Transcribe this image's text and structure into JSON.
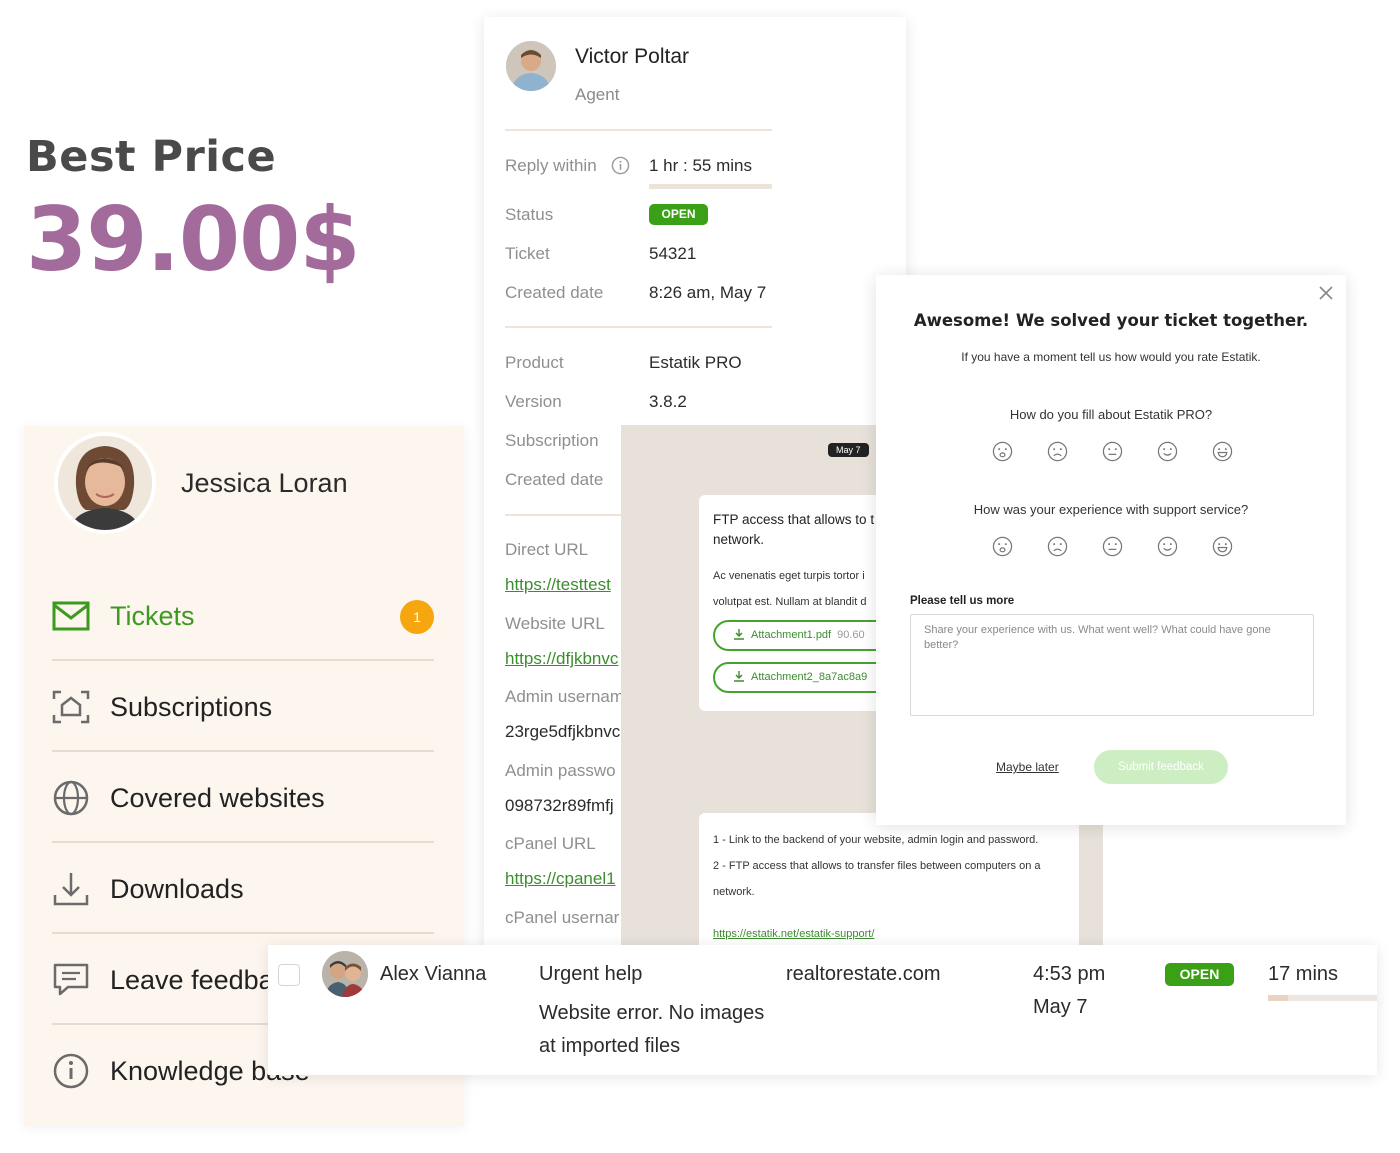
{
  "promo": {
    "label": "Best Price",
    "price": "39.00$"
  },
  "ticket_detail": {
    "agent_name": "Victor Poltar",
    "agent_role": "Agent",
    "reply_within_label": "Reply within",
    "reply_within_value": "1 hr : 55 mins",
    "status_label": "Status",
    "status_value": "OPEN",
    "ticket_label": "Ticket",
    "ticket_value": "54321",
    "created_label": "Created date",
    "created_value": "8:26 am, May 7",
    "product_label": "Product",
    "product_value": "Estatik PRO",
    "version_label": "Version",
    "version_value": "3.8.2",
    "subscription_label": "Subscription",
    "created2_label": "Created date",
    "direct_url_label": "Direct URL",
    "direct_url_value": "https://testtest",
    "website_url_label": "Website URL",
    "website_url_value": "https://dfjkbnvc",
    "admin_user_label": "Admin usernam",
    "admin_user_value": "23rge5dfjkbnvc",
    "admin_pass_label": "Admin passwo",
    "admin_pass_value": "098732r89fmfj",
    "cpanel_url_label": "cPanel URL",
    "cpanel_url_value": "https://cpanel1",
    "cpanel_user_label": "cPanel usernar"
  },
  "chat": {
    "date_chip": "May 7",
    "msg1_title": "FTP access that allows to t computers on a network.",
    "msg1_text_line1": "Ac venenatis eget turpis tortor i",
    "msg1_text_line2": "volutpat est. Nullam at blandit d",
    "attachment1_name": "Attachment1.pdf",
    "attachment1_size": "90.60",
    "attachment2_name": "Attachment2_8a7ac8a9",
    "msg2_line1": "1 - Link to the backend of your website, admin login and password.",
    "msg2_line2": "2 - FTP access that allows to transfer files between computers on a network.",
    "msg2_link": "https://estatik.net/estatik-support/"
  },
  "sidebar": {
    "user_name": "Jessica Loran",
    "items": [
      {
        "label": "Tickets",
        "badge": "1"
      },
      {
        "label": "Subscriptions"
      },
      {
        "label": "Covered websites"
      },
      {
        "label": "Downloads"
      },
      {
        "label": "Leave feedba"
      },
      {
        "label": "Knowledge base"
      }
    ]
  },
  "feedback_modal": {
    "title": "Awesome! We solved your ticket together.",
    "subtitle": "If you have a moment tell us how would you rate Estatik.",
    "question1": "How do you fill about Estatik PRO?",
    "question2": "How was your experience with support service?",
    "more_label": "Please tell us more",
    "textarea_placeholder": "Share your experience with us. What went well? What could have gone better?",
    "maybe_later": "Maybe later",
    "submit": "Submit feedback"
  },
  "ticket_row": {
    "name": "Alex Vianna",
    "subject": "Urgent help",
    "description_line1": "Website error. No images",
    "description_line2": "at imported files",
    "website": "realtorestate.com",
    "time": "4:53 pm",
    "date": "May 7",
    "status": "OPEN",
    "elapsed": "17 mins"
  },
  "colors": {
    "price": "#a36b9c",
    "green": "#3aa116",
    "link_green": "#3c8d2f",
    "badge_orange": "#f6a70f",
    "sidebar_bg": "#fdf6ef"
  }
}
